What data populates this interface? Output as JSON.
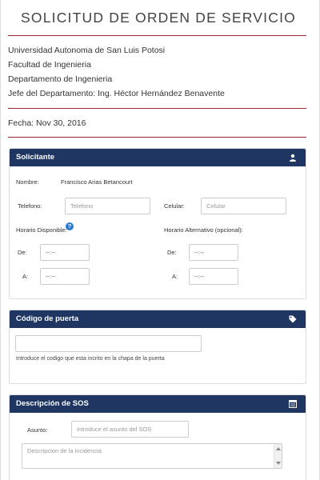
{
  "header": {
    "title": "SOLICITUD DE ORDEN DE SERVICIO",
    "university": "Universidad Autonoma de San Luis Potosi",
    "faculty": "Facultad de Ingenieria",
    "department": "Departamento de Ingenieria",
    "head_of_department": "Jefe del Departamento: Ing. Héctor Hernández Benavente",
    "date": "Fecha: Nov 30, 2016"
  },
  "colors": {
    "panel_header": "#1f3663",
    "divider": "#9b2a35",
    "help_icon": "#2a7bd1"
  },
  "solicitante": {
    "title": "Solicitante",
    "icon": "user-icon",
    "name_label": "Nombre:",
    "name_value": "Francisco Arias Betancourt",
    "telefono_label": "Telefono:",
    "telefono_placeholder": "Telefono",
    "celular_label": "Celular:",
    "celular_placeholder": "Celular",
    "horario_label": "Horario Disponible:",
    "horario_alt_label": "Horario Alternativo (opcional):",
    "de_label": "De:",
    "a_label": "A:",
    "time_placeholder": "--:--"
  },
  "codigo": {
    "title": "Código de puerta",
    "icon": "tag-icon",
    "help": "Introduce el codigo que esta incrito en la chapa de la puerta"
  },
  "sos": {
    "title": "Descripción de SOS",
    "icon": "list-icon",
    "asunto_label": "Asunto:",
    "asunto_placeholder": "introduce el asunto del SOS",
    "descripcion_placeholder": "Descripcion de la incidencia"
  }
}
